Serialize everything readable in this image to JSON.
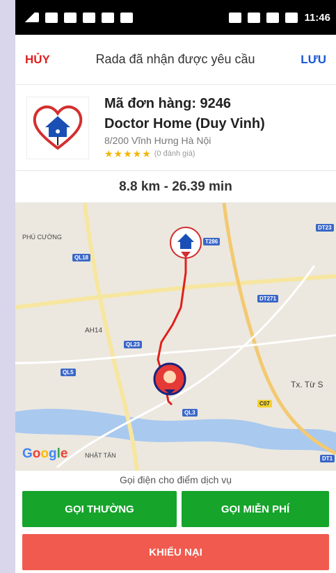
{
  "statusbar": {
    "time": "11:46"
  },
  "topbar": {
    "cancel_label": "HỦY",
    "title": "Rada đã nhận được yêu cầu",
    "save_label": "LƯU"
  },
  "order": {
    "code": "Mã đơn hàng: 9246",
    "store_name": "Doctor Home (Duy Vinh)",
    "address": "8/200 Vĩnh Hưng Hà Nội",
    "stars": "★★★★★",
    "rating_count": "(0 đánh giá)"
  },
  "distance": "8.8 km - 26.39 min",
  "map": {
    "labels": {
      "t286": "T286",
      "dt23": "DT23",
      "ql18": "QL18",
      "dt271": "DT271",
      "ah14": "AH14",
      "ql23": "QL23",
      "ql5": "QL5",
      "ql3": "QL3",
      "c07": "C07",
      "dt1": "DT1"
    },
    "places": {
      "phu_cuong": "PHÚ CƯỜNG",
      "tx_tu_son": "Tx. Từ S",
      "nhat_tan": "NHẬT TÂN"
    },
    "google_letters": [
      "G",
      "o",
      "o",
      "g",
      "l",
      "e"
    ]
  },
  "call_hint": "Gọi điện cho điểm dịch vụ",
  "buttons": {
    "normal_call": "GỌI THƯỜNG",
    "free_call": "GỌI MIỄN PHÍ",
    "complaint": "KHIẾU NẠI"
  },
  "colors": {
    "cancel": "#e02020",
    "save": "#1a57d6",
    "call": "#16a42b",
    "complaint": "#f15a4e",
    "route": "#e0201c"
  }
}
